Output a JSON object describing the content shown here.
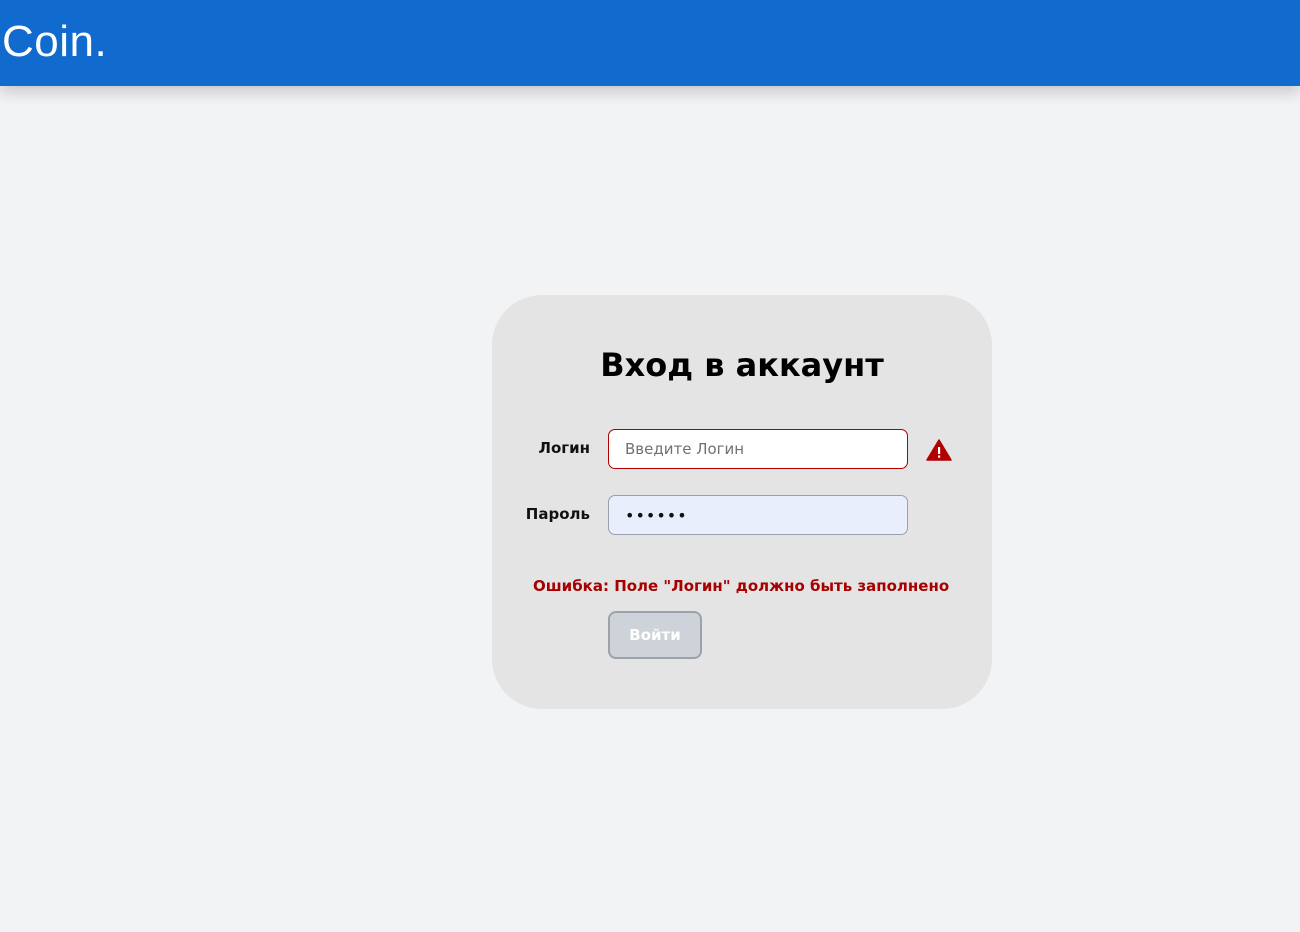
{
  "header": {
    "logo": "Coin.",
    "background_color": "#116ace"
  },
  "login_form": {
    "title": "Вход в аккаунт",
    "login_label": "Логин",
    "login_value": "",
    "login_placeholder": "Введите Логин",
    "login_has_error": true,
    "warning_icon": "warning-triangle-icon",
    "password_label": "Пароль",
    "password_value": "••••••",
    "error_message": "Ошибка: Поле \"Логин\" должно быть заполнено",
    "submit_label": "Войти",
    "submit_disabled": true,
    "error_color": "#a60000"
  }
}
